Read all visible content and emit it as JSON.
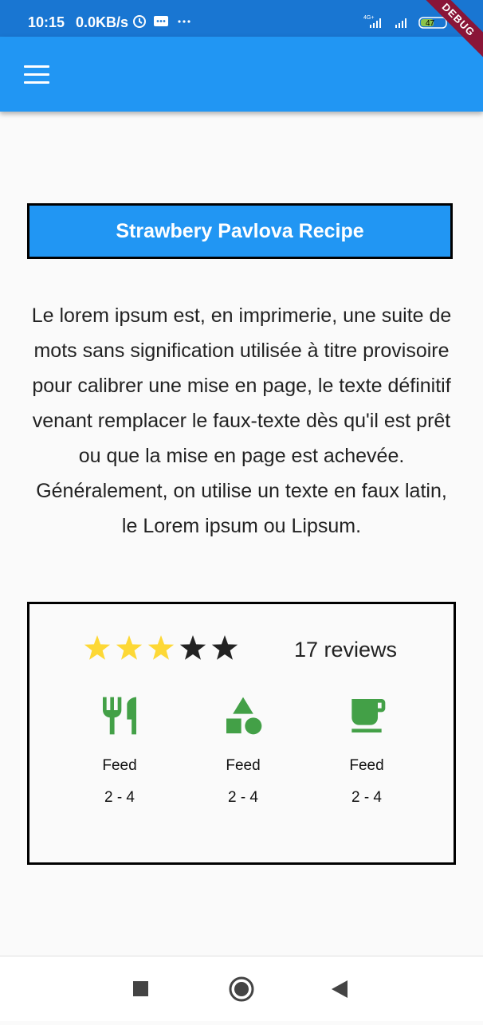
{
  "status_bar": {
    "time": "10:15",
    "speed": "0.0KB/s",
    "network": "4G+",
    "battery": "47",
    "debug_label": "DEBUG"
  },
  "app_bar": {
    "menu_icon": "menu-icon"
  },
  "recipe": {
    "title": "Strawbery Pavlova Recipe",
    "description": "Le lorem ipsum est, en imprimerie, une suite de mots sans signification utilisée à titre provisoire pour calibrer une mise en page, le texte définitif venant remplacer le faux-texte dès qu'il est prêt ou que la mise en page est achevée. Généralement, on utilise un texte en faux latin, le Lorem ipsum ou Lipsum."
  },
  "rating": {
    "stars_filled": 3,
    "stars_total": 5,
    "reviews": "17 reviews",
    "filled_color": "#fdd835",
    "empty_color": "#222222"
  },
  "stats": [
    {
      "icon": "restaurant-icon",
      "label": "Feed",
      "value": "2 - 4"
    },
    {
      "icon": "category-shapes-icon",
      "label": "Feed",
      "value": "2 - 4"
    },
    {
      "icon": "free-breakfast-icon",
      "label": "Feed",
      "value": "2 - 4"
    }
  ],
  "colors": {
    "accent": "#2196f3",
    "icon_green": "#43a047",
    "status_bar": "#1976d2"
  }
}
